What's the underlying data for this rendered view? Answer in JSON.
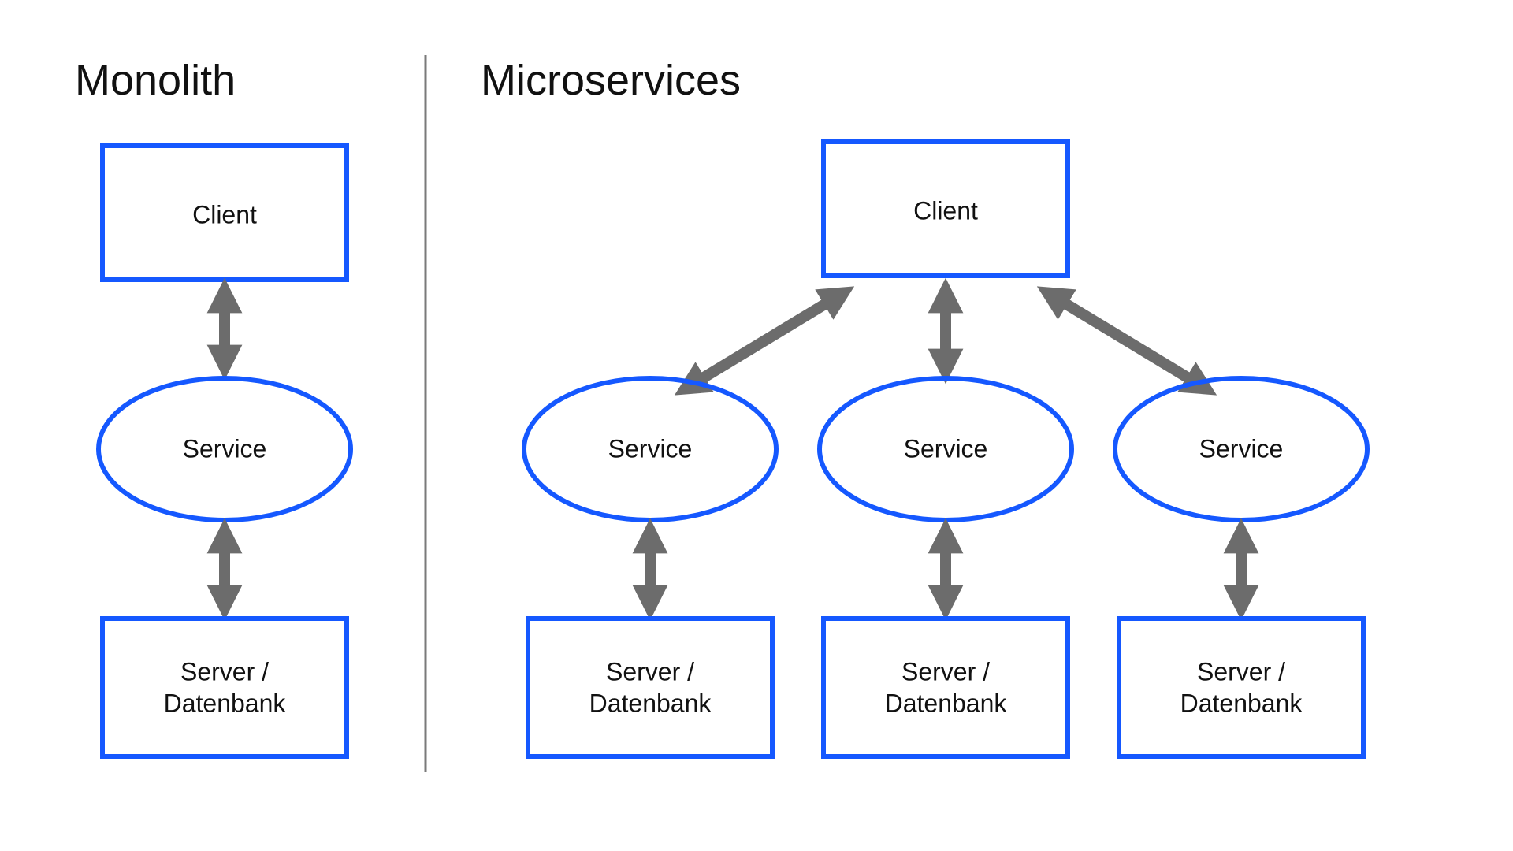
{
  "colors": {
    "node_border": "#1558ff",
    "arrow": "#6c6c6c",
    "divider": "#7a7a7a",
    "text": "#111111",
    "background": "#ffffff"
  },
  "left": {
    "title": "Monolith",
    "client": "Client",
    "service": "Service",
    "server_l1": "Server /",
    "server_l2": "Datenbank"
  },
  "right": {
    "title": "Microservices",
    "client": "Client",
    "services": [
      "Service",
      "Service",
      "Service"
    ],
    "server_l1": "Server /",
    "server_l2": "Datenbank"
  }
}
